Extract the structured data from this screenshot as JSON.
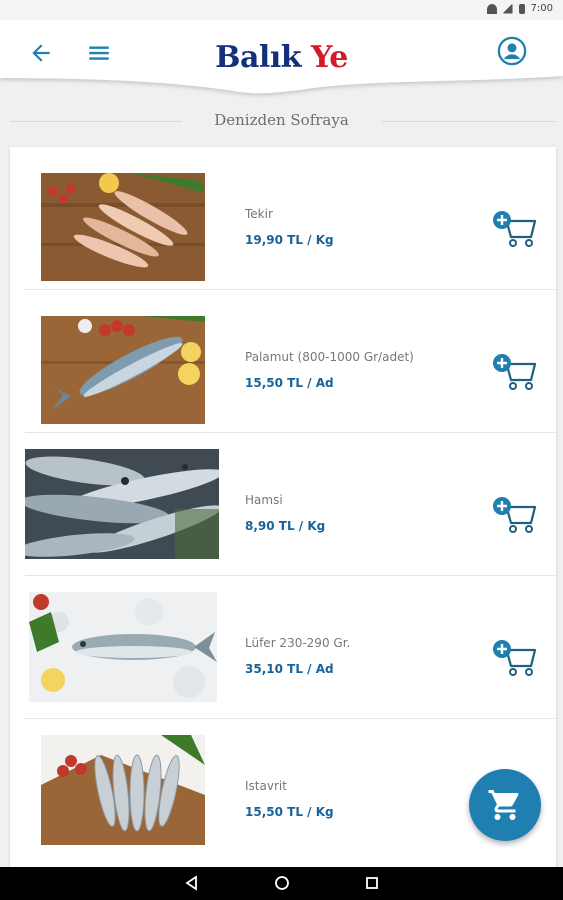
{
  "status_bar": {
    "time": "7:00"
  },
  "app": {
    "logo_part1": "Balık",
    "logo_part2": "Ye"
  },
  "section": {
    "title": "Denizden Sofraya"
  },
  "products": [
    {
      "name": "Tekir",
      "price": "19,90 TL / Kg"
    },
    {
      "name": "Palamut (800-1000 Gr/adet)",
      "price": "15,50 TL / Ad"
    },
    {
      "name": "Hamsi",
      "price": "8,90 TL / Kg"
    },
    {
      "name": "Lüfer 230-290 Gr.",
      "price": "35,10 TL / Ad"
    },
    {
      "name": "Istavrit",
      "price": "15,50 TL / Kg"
    }
  ],
  "icons": {
    "back": "arrow-left-icon",
    "menu": "hamburger-menu-icon",
    "profile": "account-circle-icon",
    "add_to_cart": "add-to-cart-icon",
    "cart": "shopping-cart-icon"
  },
  "colors": {
    "accent": "#1f7fb1",
    "price": "#17639a",
    "logo_blue": "#14307a",
    "logo_red": "#d21a2a"
  }
}
